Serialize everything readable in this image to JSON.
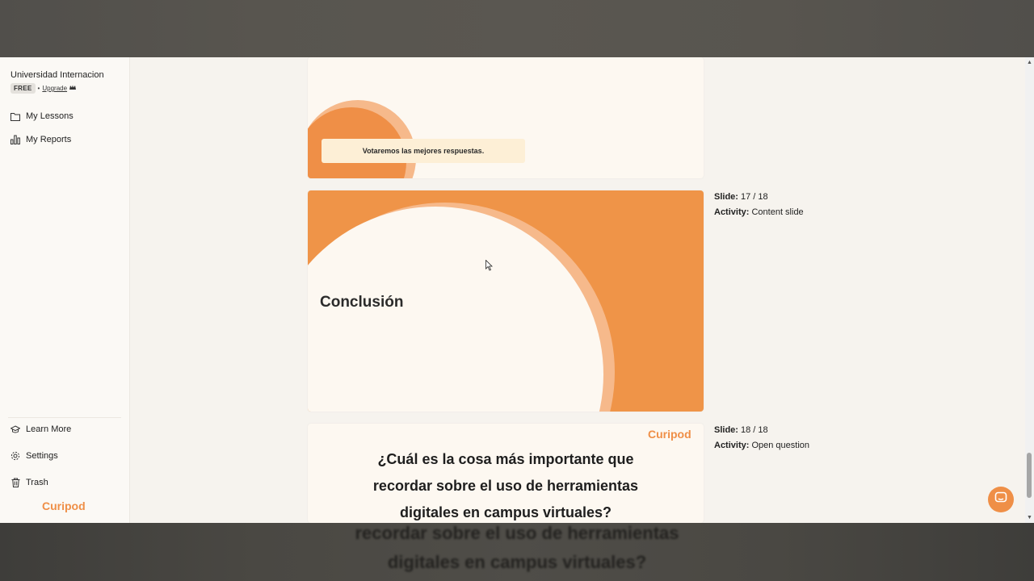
{
  "sidebar": {
    "org_name": "Universidad Internacion",
    "plan_badge": "FREE",
    "plan_separator": "•",
    "upgrade_label": "Upgrade",
    "upgrade_icon": "crown-icon",
    "nav_top": [
      {
        "label": "My Lessons",
        "icon": "folder-icon"
      },
      {
        "label": "My Reports",
        "icon": "bar-chart-icon"
      }
    ],
    "nav_bottom": [
      {
        "label": "Learn More",
        "icon": "graduation-cap-icon"
      },
      {
        "label": "Settings",
        "icon": "gear-icon"
      },
      {
        "label": "Trash",
        "icon": "trash-icon"
      }
    ],
    "logo_text": "Curipod"
  },
  "slides": [
    {
      "banner_text": "Votaremos las mejores respuestas."
    },
    {
      "title": "Conclusión",
      "meta_slide_label": "Slide:",
      "meta_slide_value": "17 / 18",
      "meta_activity_label": "Activity:",
      "meta_activity_value": "Content slide"
    },
    {
      "logo_text": "Curipod",
      "question": "¿Cuál es la cosa más importante que recordar sobre el uso de herramientas digitales en campus virtuales?",
      "meta_slide_label": "Slide:",
      "meta_slide_value": "18 / 18",
      "meta_activity_label": "Activity:",
      "meta_activity_value": "Open question"
    }
  ],
  "background_ghost": {
    "line1": "recordar sobre el uso de herramientas",
    "line2": "digitales en campus virtuales?"
  },
  "colors": {
    "accent": "#ef8f47",
    "accent_light": "#f6b98b",
    "slide_bg": "#fdf8f1",
    "window_bg": "#f6f3ee"
  },
  "chat_icon": "chat-bubble-icon"
}
